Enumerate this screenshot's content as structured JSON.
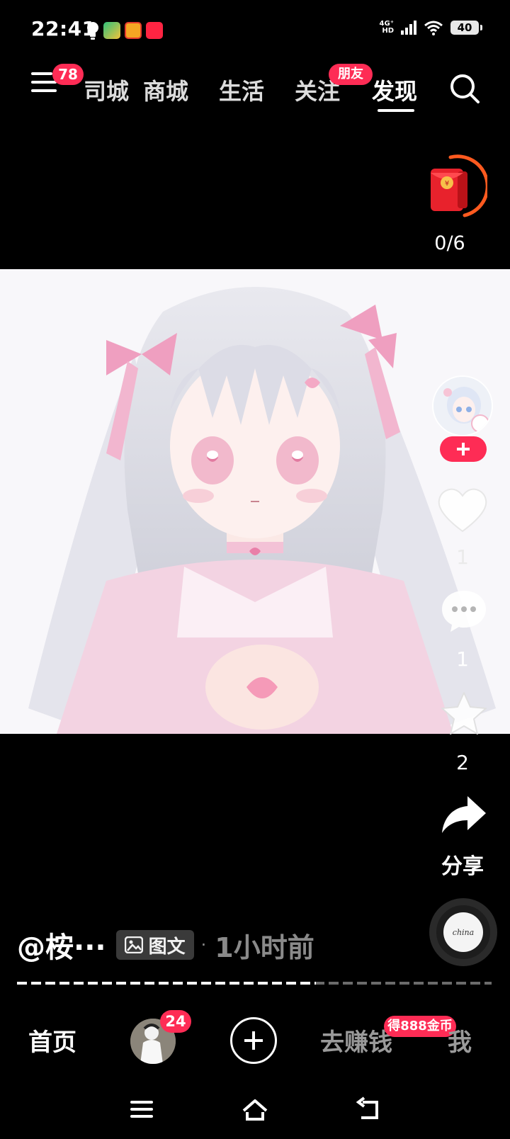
{
  "status_bar": {
    "time": "22:41",
    "network_label": "4G⁺ HD",
    "battery": "40",
    "icons": [
      "bulb-icon",
      "wallet-app-icon",
      "meituan-app-icon",
      "xiaohongshu-app-icon",
      "signal-icon",
      "wifi-icon",
      "battery-icon"
    ]
  },
  "top_nav": {
    "menu_badge": "78",
    "tabs": [
      {
        "label": "同城",
        "visible_label": "司城"
      },
      {
        "label": "商城"
      },
      {
        "label": "生活"
      },
      {
        "label": "关注"
      },
      {
        "label": "发现"
      }
    ],
    "active_tab": "发现",
    "friend_badge": "朋友"
  },
  "red_packet": {
    "progress_text": "0/6",
    "ring_color": "#ff5a1f"
  },
  "right_rail": {
    "like_count": "1",
    "comment_count": "1",
    "favorite_count": "2",
    "share_label": "分享"
  },
  "music": {
    "disc_text": "china"
  },
  "post": {
    "author": "@桉···",
    "type_label": "图文",
    "separator": "·",
    "time": "1小时前",
    "progress_fraction": 0.63
  },
  "bottom_nav": {
    "home": "首页",
    "friend_badge": "24",
    "earn": "去赚钱",
    "earn_badge": "得888金币",
    "me": "我"
  },
  "colors": {
    "accent": "#fe2c55",
    "background": "#000000"
  }
}
